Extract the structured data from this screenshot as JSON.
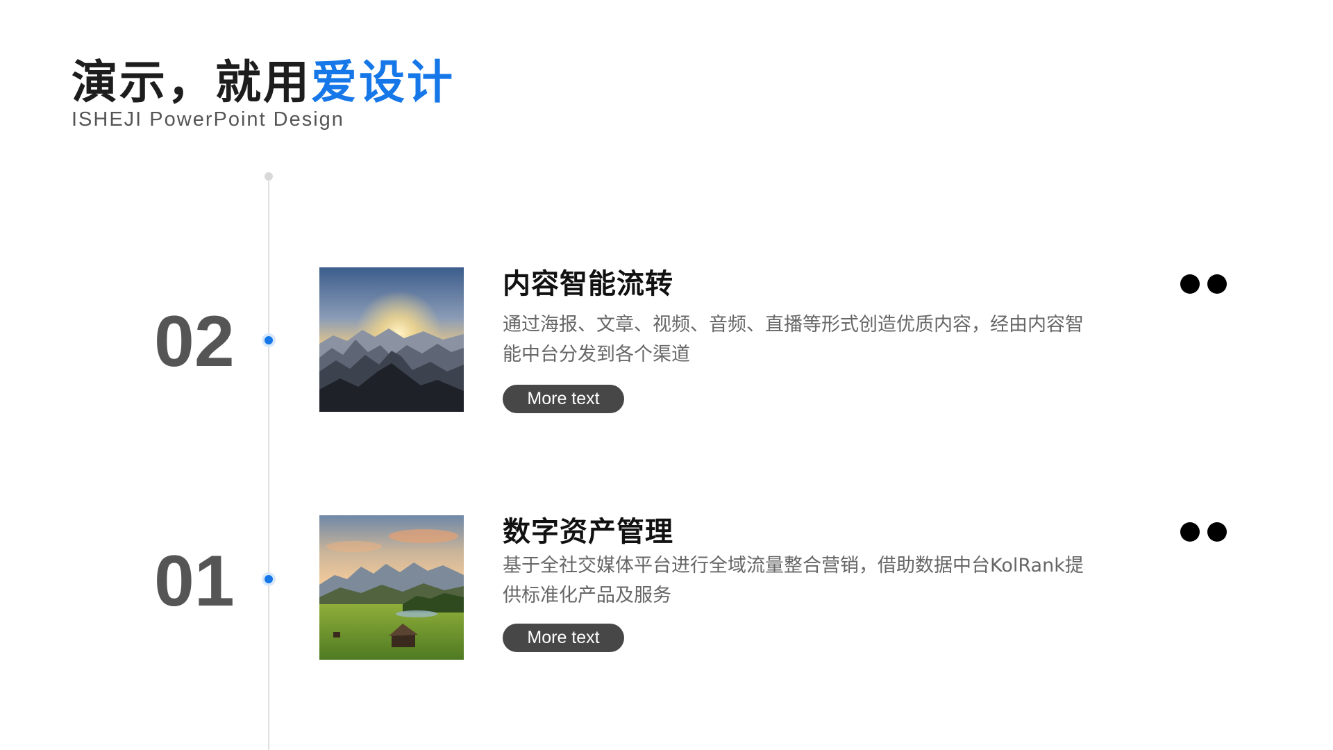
{
  "header": {
    "title_main": "演示，就用",
    "title_accent": "爱设计",
    "subtitle": "ISHEJI  PowerPoint  Design"
  },
  "colors": {
    "accent": "#1677e8",
    "number": "#555555",
    "button": "#474747"
  },
  "items": [
    {
      "number": "02",
      "title": "内容智能流转",
      "description": "通过海报、文章、视频、音频、直播等形式创造优质内容，经由内容智能中台分发到各个渠道",
      "button_label": "More text",
      "image": "mountain-sunrise-image",
      "menu_icon": "more-dots-icon"
    },
    {
      "number": "01",
      "title": "数字资产管理",
      "description": "基于全社交媒体平台进行全域流量整合营销，借助数据中台KolRank提供标准化产品及服务",
      "button_label": "More text",
      "image": "mountain-valley-cabin-image",
      "menu_icon": "more-dots-icon"
    }
  ]
}
